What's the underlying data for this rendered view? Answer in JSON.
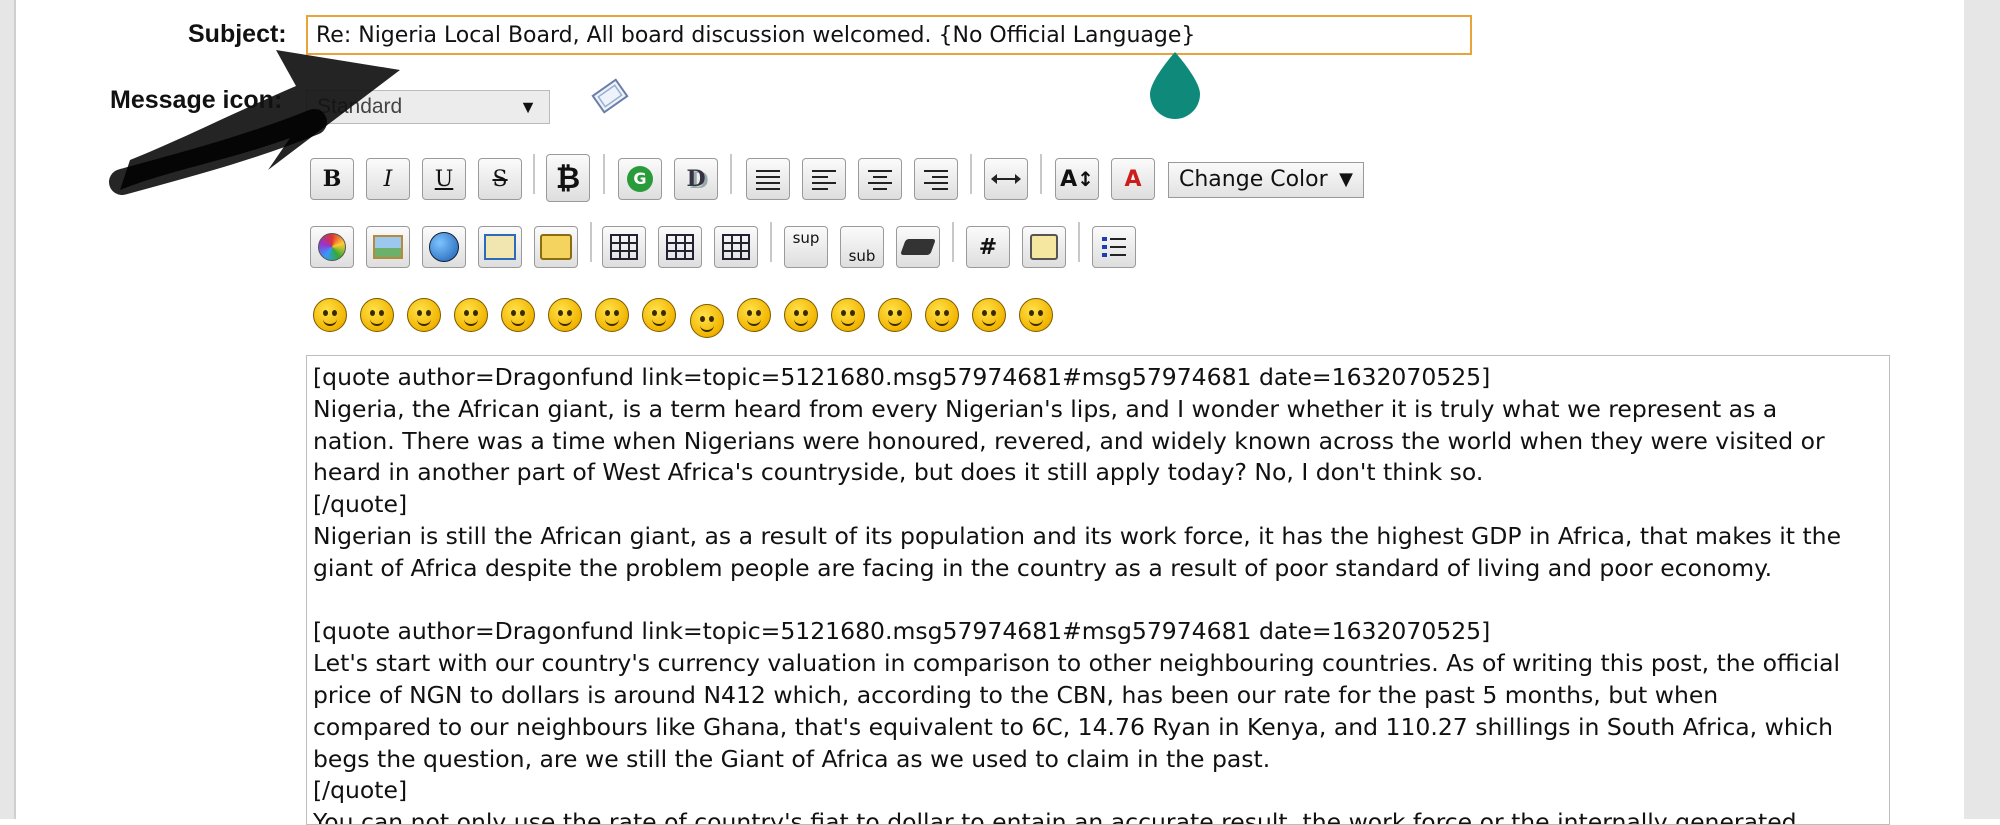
{
  "form": {
    "subject_label": "Subject:",
    "subject_value": "Re: Nigeria Local Board, All board discussion welcomed. {No Official Language}",
    "message_icon_label": "Message icon:",
    "message_icon_value": "Standard"
  },
  "toolbar": {
    "row1": [
      {
        "name": "bold-button",
        "label": "B"
      },
      {
        "name": "italic-button",
        "label": "I"
      },
      {
        "name": "underline-button",
        "label": "U"
      },
      {
        "name": "strikethrough-button",
        "label": "S"
      },
      {
        "name": "bitcoin-button",
        "label": "₿"
      },
      {
        "name": "glow-button",
        "label": "G"
      },
      {
        "name": "shadow-button",
        "label": "D"
      },
      {
        "name": "preformatted-button",
        "label": ""
      },
      {
        "name": "align-left-button",
        "label": ""
      },
      {
        "name": "align-center-button",
        "label": ""
      },
      {
        "name": "align-right-button",
        "label": ""
      },
      {
        "name": "horizontal-rule-button",
        "label": ""
      },
      {
        "name": "font-size-button",
        "label": "A"
      },
      {
        "name": "font-face-button",
        "label": "A"
      }
    ],
    "change_color_label": "Change Color",
    "row2": [
      {
        "name": "flash-button",
        "label": ""
      },
      {
        "name": "image-button",
        "label": ""
      },
      {
        "name": "link-button",
        "label": ""
      },
      {
        "name": "email-button",
        "label": ""
      },
      {
        "name": "ftp-button",
        "label": ""
      },
      {
        "name": "table-button",
        "label": ""
      },
      {
        "name": "table-row-button",
        "label": ""
      },
      {
        "name": "table-column-button",
        "label": ""
      },
      {
        "name": "superscript-button",
        "label": "sup"
      },
      {
        "name": "subscript-button",
        "label": "sub"
      },
      {
        "name": "teletype-button",
        "label": ""
      },
      {
        "name": "code-button",
        "label": "#"
      },
      {
        "name": "quote-button",
        "label": ""
      },
      {
        "name": "list-button",
        "label": ""
      }
    ]
  },
  "smileys": [
    "smiley",
    "wink",
    "cheesy",
    "grin",
    "angry",
    "sad",
    "shocked",
    "cool",
    "huh",
    "rolleyes",
    "tongue",
    "embarrassed",
    "lipsrsealed",
    "undecided",
    "kiss",
    "cry"
  ],
  "message": {
    "lines": [
      "[quote author=Dragonfund link=topic=5121680.msg57974681#msg57974681 date=1632070525]",
      "Nigeria, the African giant, is a term heard from every Nigerian's lips, and I wonder whether it is truly what we represent as a",
      "nation. There was a time when Nigerians were honoured, revered, and widely known across the world when they were visited or",
      "heard in another part of West Africa's countryside, but does it still apply today? No, I don't think so.",
      "[/quote]",
      "Nigerian is still the African giant, as a result of its population and its work force, it has the highest GDP in Africa, that makes it the",
      "giant of Africa despite the problem people are facing in the country as a result of poor standard of living and poor economy.",
      "",
      "[quote author=Dragonfund link=topic=5121680.msg57974681#msg57974681 date=1632070525]",
      "Let's start with our country's currency valuation in comparison to other neighbouring countries. As of writing this post, the official",
      "price of NGN to dollars is around N412 which, according to the CBN, has been our rate for the past 5 months, but when",
      "compared to our neighbours like Ghana, that's equivalent to 6C, 14.76 Ryan in Kenya, and 110.27 shillings in South Africa, which",
      "begs the question, are we still the Giant of Africa as we used to claim in the past.",
      "[/quote]",
      "You can not only use the rate of country's fiat to dollar to entain an accurate result, the work force or the internally generated"
    ]
  },
  "colors": {
    "subject_border": "#e8a33a",
    "cursor_drop": "#0f8a7a",
    "arrow": "#111111"
  }
}
